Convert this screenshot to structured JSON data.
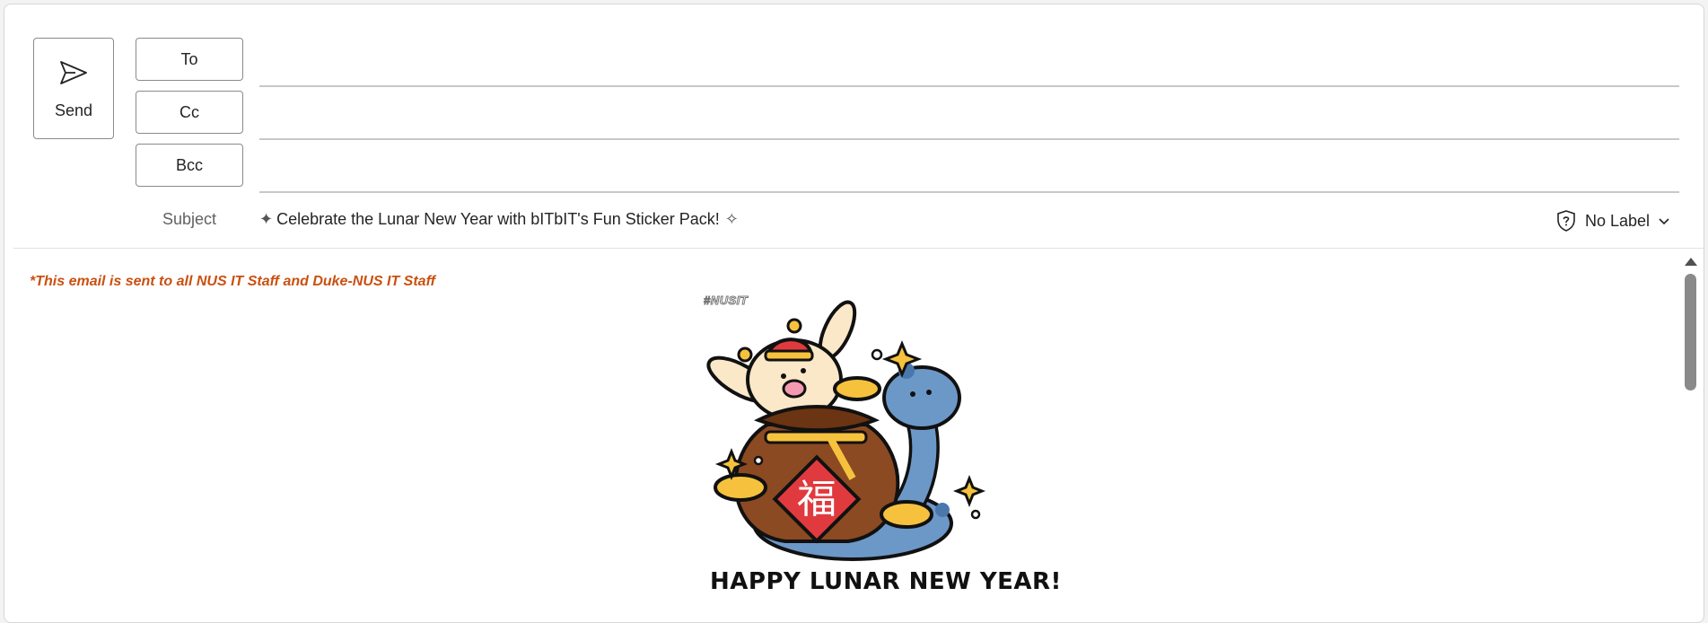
{
  "compose": {
    "send_label": "Send",
    "to_label": "To",
    "cc_label": "Cc",
    "bcc_label": "Bcc",
    "to_value": "",
    "cc_value": "",
    "bcc_value": "",
    "subject_label": "Subject",
    "subject_text": "Celebrate the Lunar New Year with bITbIT's Fun Sticker Pack!",
    "subject_leading_icon": "sparkles-icon",
    "subject_trailing_icon": "magic-wand-icon",
    "sensitivity_label": "No Label"
  },
  "body": {
    "notice": "*This email is sent to all NUS IT Staff and Duke-NUS IT Staff",
    "hashtag": "#NUSIT",
    "illustration_char": "福",
    "greeting": "HAPPY LUNAR NEW YEAR!"
  },
  "colors": {
    "notice": "#ca5010",
    "gold": "#f6c23e",
    "snake_blue": "#6c98c8",
    "bag_brown": "#8b4a22",
    "red": "#e03a3e",
    "bunny_cream": "#fbe8c8"
  }
}
